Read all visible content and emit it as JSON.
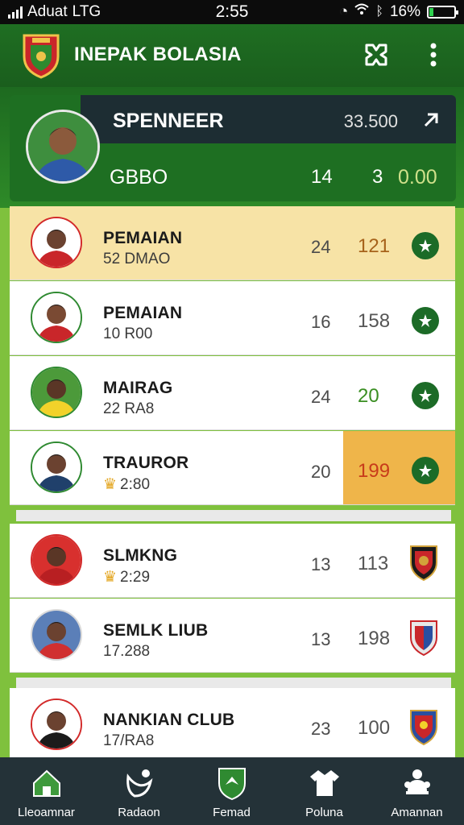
{
  "status_bar": {
    "carrier": "Aduat",
    "network": "LTG",
    "time": "2:55",
    "battery_text": "16%",
    "battery_level": 0.16
  },
  "app_bar": {
    "title": "INEPAK BOLASIA",
    "icons": [
      "club-logo",
      "swap-icon",
      "more-vert-icon"
    ]
  },
  "hero": {
    "name": "SPENNEER",
    "score": "33.500",
    "subtitle": "GBBO",
    "stat_a": "14",
    "stat_b": "3",
    "stat_c": "0.00"
  },
  "players": [
    {
      "name": "PEMAIAN",
      "sub": "52 DMAO",
      "v1": "24",
      "v2": "121",
      "crown": false,
      "end": "star-button"
    },
    {
      "name": "PEMAIAN",
      "sub": "10 R00",
      "v1": "16",
      "v2": "158",
      "crown": false,
      "end": "star-button"
    },
    {
      "name": "MAIRAG",
      "sub": "22 RA8",
      "v1": "24",
      "v2": "20",
      "crown": false,
      "end": "star-button"
    },
    {
      "name": "TRAUROR",
      "sub": "2:80",
      "v1": "20",
      "v2": "199",
      "crown": true,
      "end": "star-button"
    },
    {
      "name": "SLMKNG",
      "sub": "2:29",
      "v1": "13",
      "v2": "113",
      "crown": true,
      "end": "club-badge"
    },
    {
      "name": "SEMLK LIUB",
      "sub": "17.288",
      "v1": "13",
      "v2": "198",
      "crown": false,
      "end": "club-badge"
    },
    {
      "name": "NANKIAN CLUB",
      "sub": "17/RA8",
      "v1": "23",
      "v2": "100",
      "crown": false,
      "end": "club-badge"
    }
  ],
  "bottom_nav": [
    {
      "label": "Lleoamnar",
      "icon": "home-icon"
    },
    {
      "label": "Radaon",
      "icon": "player-icon"
    },
    {
      "label": "Femad",
      "icon": "shield-icon"
    },
    {
      "label": "Poluna",
      "icon": "shirt-icon"
    },
    {
      "label": "Amannan",
      "icon": "bell-icon"
    }
  ],
  "colors": {
    "primary_green": "#1f6e22",
    "background_green": "#7fc13d",
    "highlight_row": "#f7e3a6",
    "accent_orange": "#efb54a",
    "nav_bg": "#243238"
  }
}
